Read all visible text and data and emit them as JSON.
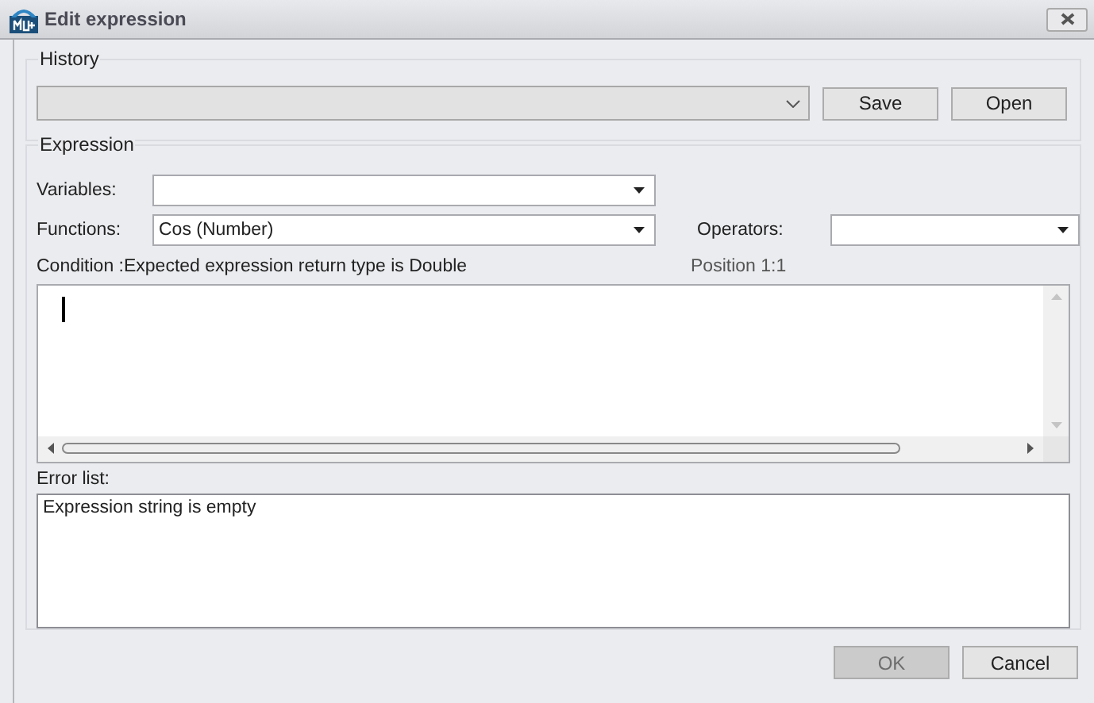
{
  "window": {
    "title": "Edit expression"
  },
  "history": {
    "label": "History",
    "combo": {
      "disabled": true
    },
    "buttons": [
      {
        "label": "Save",
        "disabled": false
      },
      {
        "label": "Open",
        "disabled": false
      }
    ]
  },
  "expression": {
    "label": "Expression",
    "variables": {
      "label": "Variables:"
    },
    "functions": {
      "label": "Functions:",
      "value": "Cos (Number)"
    },
    "operators": {
      "label": "Operators:"
    },
    "condition": "Condition :Expected expression return type is Double",
    "position": "Position 1:1"
  },
  "error_list": {
    "label": "Error list:",
    "items": [
      "Expression string is empty"
    ]
  },
  "buttons": [
    {
      "label": "OK",
      "disabled": true
    },
    {
      "label": "Cancel",
      "disabled": false
    }
  ]
}
